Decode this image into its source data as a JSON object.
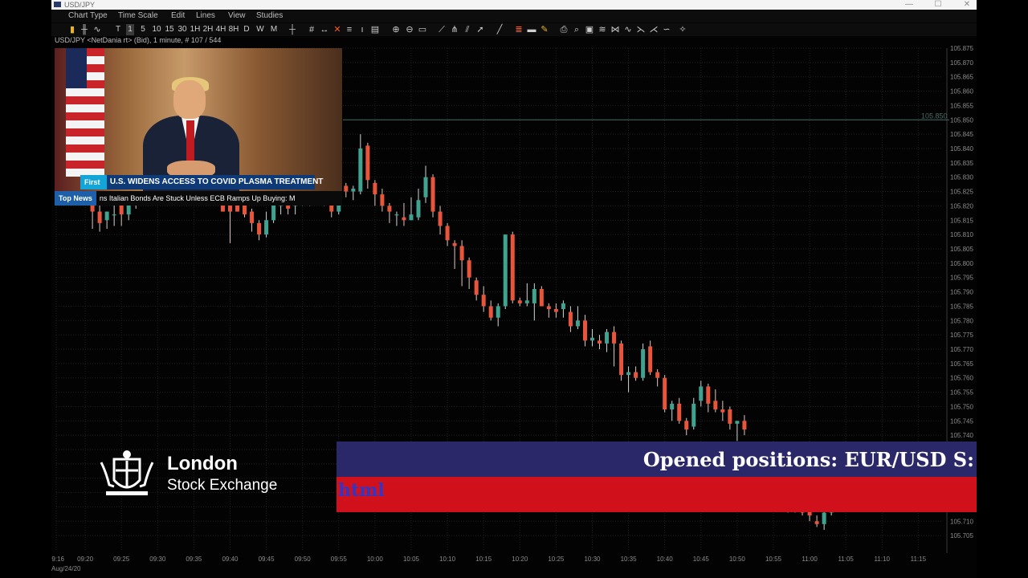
{
  "window": {
    "title": "USD/JPY",
    "controls": [
      "—",
      "☐",
      "✕"
    ]
  },
  "menubar": {
    "items": [
      "Chart Type",
      "Time Scale",
      "Edit",
      "Lines",
      "View",
      "Studies"
    ]
  },
  "toolbar": {
    "timeframes": [
      "T",
      "1",
      "5",
      "10",
      "15",
      "30",
      "1H",
      "2H",
      "4H",
      "8H",
      "D",
      "W",
      "M"
    ]
  },
  "symbol_line": "USD/JPY <NetDania rt> (Bid), 1 minute, # 107 / 544",
  "chart_data": {
    "type": "candlestick",
    "title": "",
    "xlabel": "",
    "ylabel": "",
    "ylim": [
      105.7,
      105.875
    ],
    "y_ticks": [
      "105.875",
      "105.870",
      "105.865",
      "105.860",
      "105.855",
      "105.850",
      "105.845",
      "105.840",
      "105.835",
      "105.830",
      "105.825",
      "105.820",
      "105.815",
      "105.810",
      "105.805",
      "105.800",
      "105.795",
      "105.790",
      "105.785",
      "105.780",
      "105.775",
      "105.770",
      "105.765",
      "105.760",
      "105.755",
      "105.750",
      "105.745",
      "105.740",
      "105.735",
      "105.730",
      "105.725",
      "105.720",
      "105.715",
      "105.710",
      "105.705"
    ],
    "x_ticks": [
      "09:16",
      "09:20",
      "09:25",
      "09:30",
      "09:35",
      "09:40",
      "09:45",
      "09:50",
      "09:55",
      "10:00",
      "10:05",
      "10:10",
      "10:15",
      "10:20",
      "10:25",
      "10:30",
      "10:35",
      "10:40",
      "10:45",
      "10:50",
      "10:55",
      "11:00",
      "11:05",
      "11:10",
      "11:15"
    ],
    "date_label": "Aug/24/20",
    "horizontal_line": {
      "value": 105.85,
      "label": "105.850"
    },
    "colors": {
      "up": "#3fa38f",
      "down": "#e8553a",
      "grid": "#202020",
      "text": "#8c8c8c",
      "hline": "#4a6b66"
    },
    "candles": [
      {
        "t": "09:21",
        "o": 105.823,
        "h": 105.824,
        "l": 105.812,
        "c": 105.818
      },
      {
        "t": "09:22",
        "o": 105.818,
        "h": 105.821,
        "l": 105.811,
        "c": 105.814
      },
      {
        "t": "09:23",
        "o": 105.815,
        "h": 105.818,
        "l": 105.812,
        "c": 105.818
      },
      {
        "t": "09:24",
        "o": 105.817,
        "h": 105.822,
        "l": 105.813,
        "c": 105.817
      },
      {
        "t": "09:25",
        "o": 105.821,
        "h": 105.823,
        "l": 105.813,
        "c": 105.817
      },
      {
        "t": "09:26",
        "o": 105.817,
        "h": 105.825,
        "l": 105.815,
        "c": 105.824
      },
      {
        "t": "09:27",
        "o": 105.823,
        "h": 105.824,
        "l": 105.819,
        "c": 105.822
      },
      {
        "t": "09:39",
        "o": 105.824,
        "h": 105.825,
        "l": 105.818,
        "c": 105.818
      },
      {
        "t": "09:40",
        "o": 105.823,
        "h": 105.825,
        "l": 105.807,
        "c": 105.818
      },
      {
        "t": "09:41",
        "o": 105.822,
        "h": 105.823,
        "l": 105.818,
        "c": 105.818
      },
      {
        "t": "09:42",
        "o": 105.823,
        "h": 105.826,
        "l": 105.816,
        "c": 105.817
      },
      {
        "t": "09:43",
        "o": 105.818,
        "h": 105.819,
        "l": 105.811,
        "c": 105.814
      },
      {
        "t": "09:44",
        "o": 105.814,
        "h": 105.815,
        "l": 105.808,
        "c": 105.81
      },
      {
        "t": "09:45",
        "o": 105.81,
        "h": 105.818,
        "l": 105.809,
        "c": 105.815
      },
      {
        "t": "09:46",
        "o": 105.815,
        "h": 105.823,
        "l": 105.814,
        "c": 105.821
      },
      {
        "t": "09:47",
        "o": 105.82,
        "h": 105.823,
        "l": 105.817,
        "c": 105.822
      },
      {
        "t": "09:48",
        "o": 105.822,
        "h": 105.823,
        "l": 105.817,
        "c": 105.819
      },
      {
        "t": "09:49",
        "o": 105.82,
        "h": 105.826,
        "l": 105.817,
        "c": 105.823
      },
      {
        "t": "09:50",
        "o": 105.823,
        "h": 105.833,
        "l": 105.82,
        "c": 105.825
      },
      {
        "t": "09:51",
        "o": 105.825,
        "h": 105.838,
        "l": 105.82,
        "c": 105.828
      },
      {
        "t": "09:52",
        "o": 105.828,
        "h": 105.836,
        "l": 105.821,
        "c": 105.826
      },
      {
        "t": "09:53",
        "o": 105.826,
        "h": 105.827,
        "l": 105.82,
        "c": 105.825
      },
      {
        "t": "09:54",
        "o": 105.825,
        "h": 105.826,
        "l": 105.816,
        "c": 105.818
      },
      {
        "t": "09:55",
        "o": 105.818,
        "h": 105.828,
        "l": 105.817,
        "c": 105.827
      },
      {
        "t": "09:56",
        "o": 105.827,
        "h": 105.828,
        "l": 105.823,
        "c": 105.825
      },
      {
        "t": "09:57",
        "o": 105.825,
        "h": 105.827,
        "l": 105.822,
        "c": 105.826
      },
      {
        "t": "09:58",
        "o": 105.825,
        "h": 105.845,
        "l": 105.824,
        "c": 105.84
      },
      {
        "t": "09:59",
        "o": 105.841,
        "h": 105.842,
        "l": 105.826,
        "c": 105.829
      },
      {
        "t": "10:00",
        "o": 105.828,
        "h": 105.829,
        "l": 105.82,
        "c": 105.824
      },
      {
        "t": "10:01",
        "o": 105.824,
        "h": 105.826,
        "l": 105.818,
        "c": 105.82
      },
      {
        "t": "10:02",
        "o": 105.82,
        "h": 105.821,
        "l": 105.814,
        "c": 105.818
      },
      {
        "t": "10:03",
        "o": 105.817,
        "h": 105.818,
        "l": 105.813,
        "c": 105.817
      },
      {
        "t": "10:04",
        "o": 105.816,
        "h": 105.821,
        "l": 105.813,
        "c": 105.815
      },
      {
        "t": "10:05",
        "o": 105.815,
        "h": 105.823,
        "l": 105.815,
        "c": 105.817
      },
      {
        "t": "10:06",
        "o": 105.816,
        "h": 105.826,
        "l": 105.815,
        "c": 105.822
      },
      {
        "t": "10:07",
        "o": 105.823,
        "h": 105.834,
        "l": 105.821,
        "c": 105.83
      },
      {
        "t": "10:08",
        "o": 105.83,
        "h": 105.831,
        "l": 105.816,
        "c": 105.818
      },
      {
        "t": "10:09",
        "o": 105.818,
        "h": 105.82,
        "l": 105.81,
        "c": 105.813
      },
      {
        "t": "10:10",
        "o": 105.813,
        "h": 105.814,
        "l": 105.806,
        "c": 105.808
      },
      {
        "t": "10:11",
        "o": 105.807,
        "h": 105.808,
        "l": 105.798,
        "c": 105.806
      },
      {
        "t": "10:12",
        "o": 105.806,
        "h": 105.808,
        "l": 105.792,
        "c": 105.801
      },
      {
        "t": "10:13",
        "o": 105.801,
        "h": 105.802,
        "l": 105.791,
        "c": 105.795
      },
      {
        "t": "10:14",
        "o": 105.794,
        "h": 105.795,
        "l": 105.787,
        "c": 105.789
      },
      {
        "t": "10:15",
        "o": 105.789,
        "h": 105.792,
        "l": 105.783,
        "c": 105.785
      },
      {
        "t": "10:16",
        "o": 105.785,
        "h": 105.787,
        "l": 105.78,
        "c": 105.781
      },
      {
        "t": "10:17",
        "o": 105.781,
        "h": 105.786,
        "l": 105.778,
        "c": 105.785
      },
      {
        "t": "10:18",
        "o": 105.785,
        "h": 105.81,
        "l": 105.784,
        "c": 105.81
      },
      {
        "t": "10:19",
        "o": 105.81,
        "h": 105.811,
        "l": 105.786,
        "c": 105.787
      },
      {
        "t": "10:20",
        "o": 105.787,
        "h": 105.788,
        "l": 105.785,
        "c": 105.786
      },
      {
        "t": "10:21",
        "o": 105.786,
        "h": 105.793,
        "l": 105.785,
        "c": 105.787
      },
      {
        "t": "10:22",
        "o": 105.786,
        "h": 105.793,
        "l": 105.78,
        "c": 105.791
      },
      {
        "t": "10:23",
        "o": 105.791,
        "h": 105.792,
        "l": 105.785,
        "c": 105.785
      },
      {
        "t": "10:24",
        "o": 105.785,
        "h": 105.786,
        "l": 105.781,
        "c": 105.784
      },
      {
        "t": "10:25",
        "o": 105.784,
        "h": 105.786,
        "l": 105.781,
        "c": 105.783
      },
      {
        "t": "10:26",
        "o": 105.784,
        "h": 105.787,
        "l": 105.781,
        "c": 105.786
      },
      {
        "t": "10:27",
        "o": 105.783,
        "h": 105.785,
        "l": 105.776,
        "c": 105.778
      },
      {
        "t": "10:28",
        "o": 105.778,
        "h": 105.785,
        "l": 105.777,
        "c": 105.78
      },
      {
        "t": "10:29",
        "o": 105.78,
        "h": 105.782,
        "l": 105.771,
        "c": 105.773
      },
      {
        "t": "10:30",
        "o": 105.773,
        "h": 105.777,
        "l": 105.771,
        "c": 105.774
      },
      {
        "t": "10:31",
        "o": 105.773,
        "h": 105.775,
        "l": 105.77,
        "c": 105.772
      },
      {
        "t": "10:32",
        "o": 105.772,
        "h": 105.777,
        "l": 105.769,
        "c": 105.776
      },
      {
        "t": "10:33",
        "o": 105.776,
        "h": 105.778,
        "l": 105.764,
        "c": 105.772
      },
      {
        "t": "10:34",
        "o": 105.772,
        "h": 105.773,
        "l": 105.759,
        "c": 105.761
      },
      {
        "t": "10:35",
        "o": 105.761,
        "h": 105.764,
        "l": 105.755,
        "c": 105.762
      },
      {
        "t": "10:36",
        "o": 105.762,
        "h": 105.764,
        "l": 105.759,
        "c": 105.76
      },
      {
        "t": "10:37",
        "o": 105.76,
        "h": 105.772,
        "l": 105.759,
        "c": 105.77
      },
      {
        "t": "10:38",
        "o": 105.771,
        "h": 105.773,
        "l": 105.761,
        "c": 105.762
      },
      {
        "t": "10:39",
        "o": 105.762,
        "h": 105.763,
        "l": 105.757,
        "c": 105.76
      },
      {
        "t": "10:40",
        "o": 105.76,
        "h": 105.761,
        "l": 105.748,
        "c": 105.749
      },
      {
        "t": "10:41",
        "o": 105.749,
        "h": 105.752,
        "l": 105.745,
        "c": 105.751
      },
      {
        "t": "10:42",
        "o": 105.751,
        "h": 105.753,
        "l": 105.744,
        "c": 105.745
      },
      {
        "t": "10:43",
        "o": 105.745,
        "h": 105.746,
        "l": 105.74,
        "c": 105.742
      },
      {
        "t": "10:44",
        "o": 105.743,
        "h": 105.753,
        "l": 105.742,
        "c": 105.751
      },
      {
        "t": "10:45",
        "o": 105.752,
        "h": 105.759,
        "l": 105.75,
        "c": 105.757
      },
      {
        "t": "10:46",
        "o": 105.757,
        "h": 105.758,
        "l": 105.748,
        "c": 105.751
      },
      {
        "t": "10:47",
        "o": 105.752,
        "h": 105.756,
        "l": 105.748,
        "c": 105.749
      },
      {
        "t": "10:48",
        "o": 105.749,
        "h": 105.752,
        "l": 105.745,
        "c": 105.748
      },
      {
        "t": "10:49",
        "o": 105.749,
        "h": 105.75,
        "l": 105.742,
        "c": 105.744
      },
      {
        "t": "10:50",
        "o": 105.744,
        "h": 105.745,
        "l": 105.738,
        "c": 105.745
      },
      {
        "t": "10:51",
        "o": 105.745,
        "h": 105.747,
        "l": 105.74,
        "c": 105.742
      },
      {
        "t": "10:56",
        "o": 105.717,
        "h": 105.719,
        "l": 105.715,
        "c": 105.716
      },
      {
        "t": "10:57",
        "o": 105.716,
        "h": 105.717,
        "l": 105.713,
        "c": 105.715
      },
      {
        "t": "10:58",
        "o": 105.718,
        "h": 105.719,
        "l": 105.713,
        "c": 105.714
      },
      {
        "t": "10:59",
        "o": 105.715,
        "h": 105.716,
        "l": 105.712,
        "c": 105.713
      },
      {
        "t": "11:00",
        "o": 105.717,
        "h": 105.719,
        "l": 105.71,
        "c": 105.712
      },
      {
        "t": "11:01",
        "o": 105.71,
        "h": 105.712,
        "l": 105.708,
        "c": 105.709
      },
      {
        "t": "11:02",
        "o": 105.709,
        "h": 105.714,
        "l": 105.707,
        "c": 105.713
      },
      {
        "t": "11:03",
        "o": 105.713,
        "h": 105.718,
        "l": 105.712,
        "c": 105.717
      }
    ]
  },
  "news": {
    "tag_first_word": "First Word",
    "headline": "U.S. WIDENS ACCESS TO COVID PLASMA TREATMENT",
    "tag_top_news": "Top News",
    "ticker": "ns    Italian Bonds Are Stuck Unless ECB Ramps Up Buying: M"
  },
  "overlay_logo": {
    "line1": "London",
    "line2": "Stock Exchange"
  },
  "banner": {
    "top_text": "Opened positions: EUR/USD S:",
    "bottom_text": "html",
    "colors": {
      "top": "#2a2868",
      "bottom": "#d0111c"
    }
  }
}
